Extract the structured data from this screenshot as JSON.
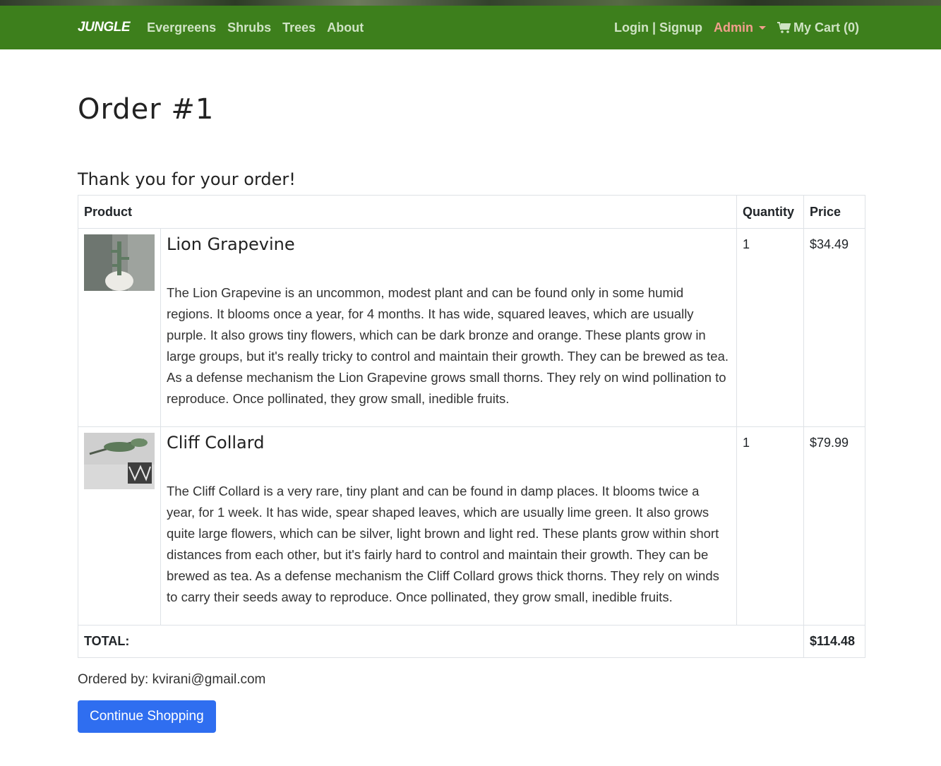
{
  "nav": {
    "brand": "JUNGLE",
    "links": [
      "Evergreens",
      "Shrubs",
      "Trees",
      "About"
    ],
    "auth": "Login | Signup",
    "admin": "Admin",
    "cart": "My Cart (0)"
  },
  "order": {
    "title": "Order #1",
    "thanks": "Thank you for your order!",
    "headers": {
      "product": "Product",
      "quantity": "Quantity",
      "price": "Price"
    },
    "items": [
      {
        "name": "Lion Grapevine",
        "description": "The Lion Grapevine is an uncommon, modest plant and can be found only in some humid regions. It blooms once a year, for 4 months. It has wide, squared leaves, which are usually purple. It also grows tiny flowers, which can be dark bronze and orange. These plants grow in large groups, but it's really tricky to control and maintain their growth. They can be brewed as tea. As a defense mechanism the Lion Grapevine grows small thorns. They rely on wind pollination to reproduce. Once pollinated, they grow small, inedible fruits.",
        "quantity": "1",
        "price": "$34.49"
      },
      {
        "name": "Cliff Collard",
        "description": "The Cliff Collard is a very rare, tiny plant and can be found in damp places. It blooms twice a year, for 1 week. It has wide, spear shaped leaves, which are usually lime green. It also grows quite large flowers, which can be silver, light brown and light red. These plants grow within short distances from each other, but it's fairly hard to control and maintain their growth. They can be brewed as tea. As a defense mechanism the Cliff Collard grows thick thorns. They rely on winds to carry their seeds away to reproduce. Once pollinated, they grow small, inedible fruits.",
        "quantity": "1",
        "price": "$79.99"
      }
    ],
    "total_label": "TOTAL:",
    "total": "$114.48",
    "ordered_by": "Ordered by: kvirani@gmail.com"
  },
  "continue_button": "Continue Shopping",
  "colors": {
    "navbar": "#3d7f1c",
    "admin": "#f29f8c",
    "button": "#2f6ef0"
  },
  "icons": [
    "shopping-cart-icon",
    "caret-down-icon",
    "product-photo"
  ]
}
